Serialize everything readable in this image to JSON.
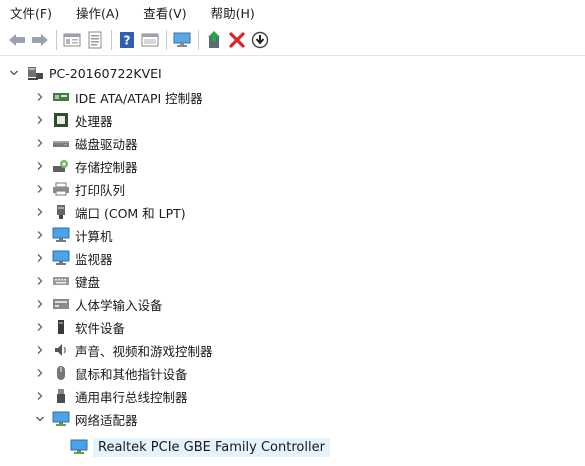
{
  "menu": [
    "文件(F)",
    "操作(A)",
    "查看(V)",
    "帮助(H)"
  ],
  "toolbar_icons": [
    "back-icon",
    "forward-icon",
    "properties-icon",
    "details-icon",
    "help-icon",
    "view-icon",
    "monitor-icon",
    "update-driver-icon",
    "uninstall-icon",
    "scan-icon"
  ],
  "tree": {
    "root": "PC-20160722KVEI",
    "categories": [
      {
        "label": "IDE ATA/ATAPI 控制器",
        "icon": "ide-controller-icon"
      },
      {
        "label": "处理器",
        "icon": "processor-icon"
      },
      {
        "label": "磁盘驱动器",
        "icon": "disk-drive-icon"
      },
      {
        "label": "存储控制器",
        "icon": "storage-controller-icon"
      },
      {
        "label": "打印队列",
        "icon": "printer-icon"
      },
      {
        "label": "端口 (COM 和 LPT)",
        "icon": "port-icon"
      },
      {
        "label": "计算机",
        "icon": "computer-icon"
      },
      {
        "label": "监视器",
        "icon": "monitor-device-icon"
      },
      {
        "label": "键盘",
        "icon": "keyboard-icon"
      },
      {
        "label": "人体学输入设备",
        "icon": "hid-icon"
      },
      {
        "label": "软件设备",
        "icon": "software-device-icon"
      },
      {
        "label": "声音、视频和游戏控制器",
        "icon": "sound-icon"
      },
      {
        "label": "鼠标和其他指针设备",
        "icon": "mouse-icon"
      },
      {
        "label": "通用串行总线控制器",
        "icon": "usb-icon"
      },
      {
        "label": "网络适配器",
        "icon": "network-adapter-icon"
      }
    ],
    "expanded_child": "Realtek PCIe GBE Family Controller"
  }
}
